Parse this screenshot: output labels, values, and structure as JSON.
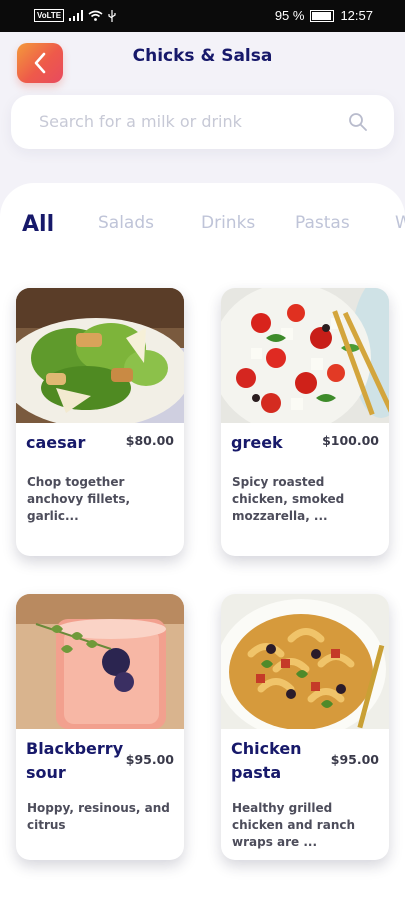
{
  "status_bar": {
    "network": "VoLTE",
    "battery": "95 %",
    "time": "12:57"
  },
  "header": {
    "title": "Chicks & Salsa",
    "back_icon": "chevron-left-icon"
  },
  "search": {
    "placeholder": "Search for a milk or drink",
    "icon": "search-icon"
  },
  "tabs": [
    "All",
    "Salads",
    "Drinks",
    "Pastas",
    "W"
  ],
  "active_tab": "All",
  "items": [
    {
      "name": "caesar",
      "price": "$80.00",
      "description": "Chop together anchovy fillets, garlic..."
    },
    {
      "name": "greek",
      "price": "$100.00",
      "description": "Spicy roasted chicken, smoked mozzarella, ..."
    },
    {
      "name": "Blackberry sour",
      "price": "$95.00",
      "description": "Hoppy, resinous, and citrus"
    },
    {
      "name": "Chicken pasta",
      "price": "$95.00",
      "description": "Healthy grilled chicken and ranch wraps are ..."
    }
  ],
  "colors": {
    "accent_gradient_start": "#f39a3b",
    "accent_gradient_end": "#e84a5f",
    "title": "#17196a",
    "inactive_tab": "#bfc4d8"
  }
}
